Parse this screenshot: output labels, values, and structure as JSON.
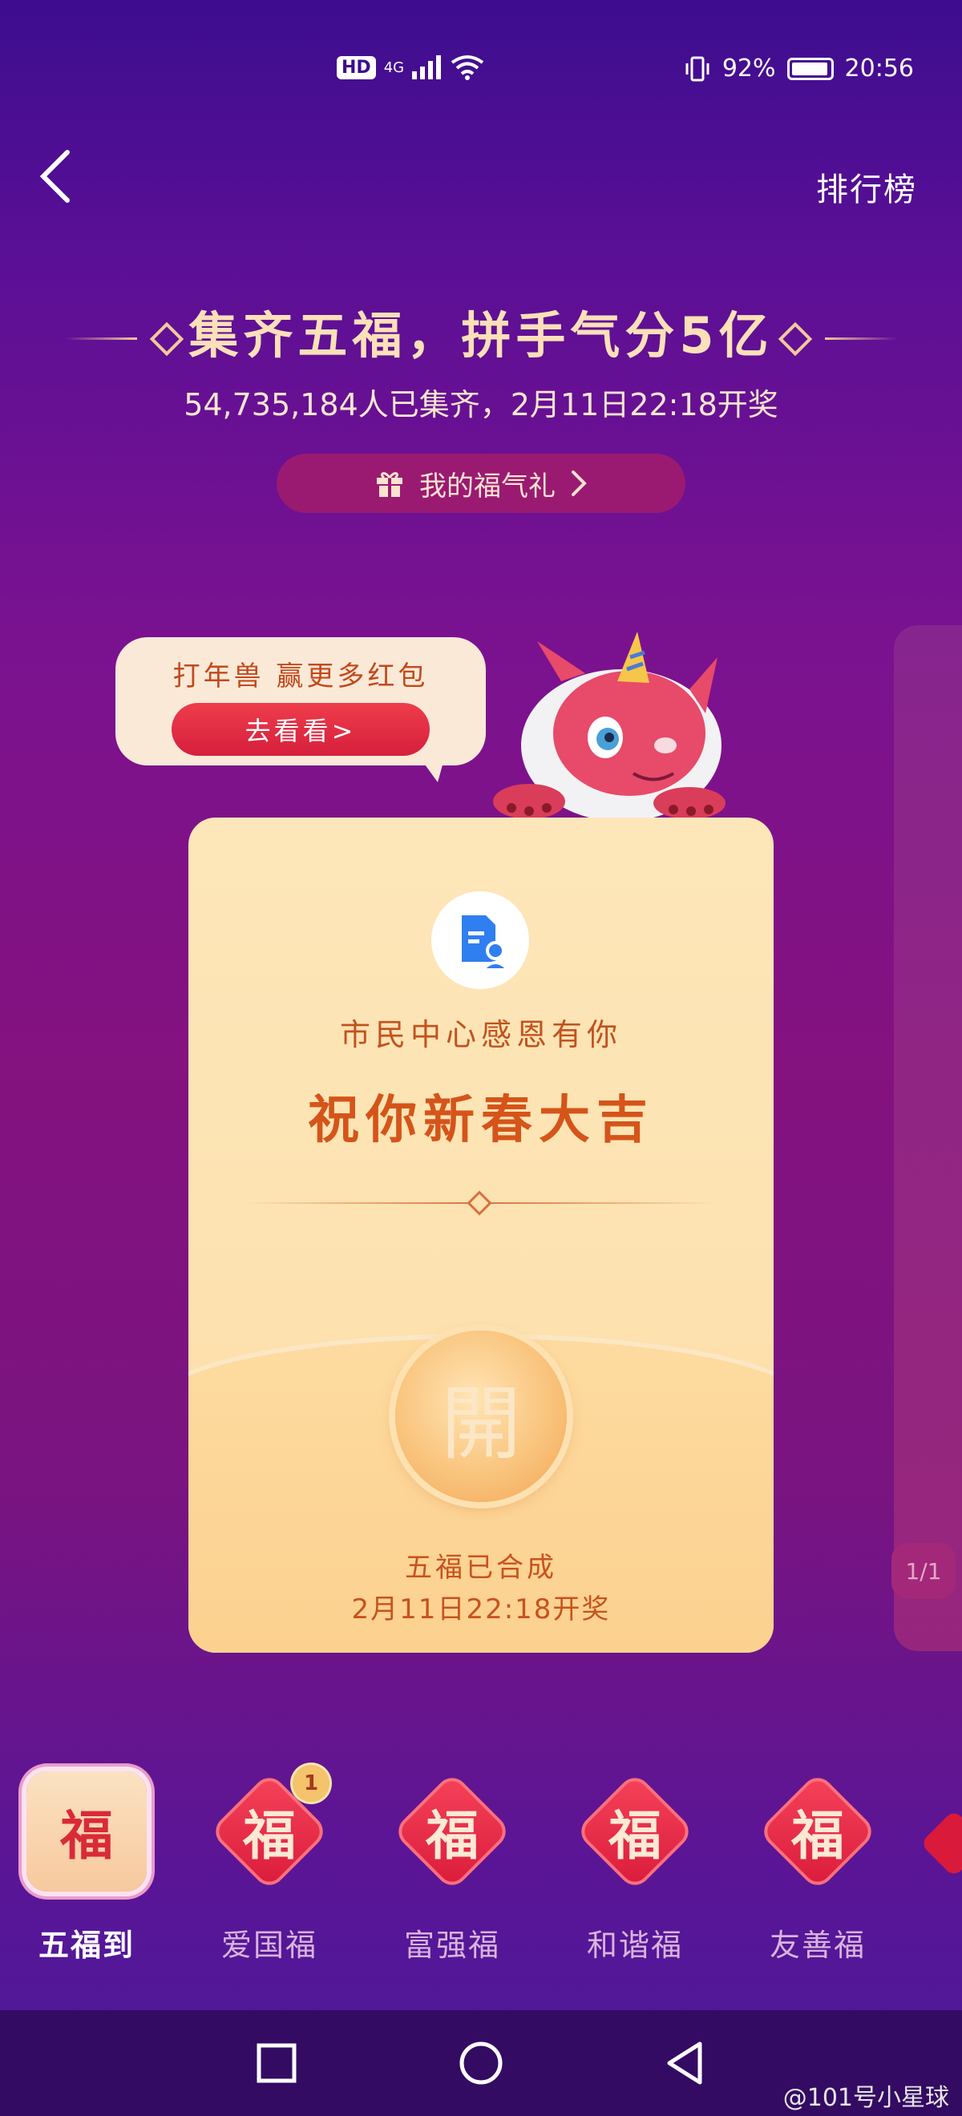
{
  "status_bar": {
    "network": "HD",
    "signal": "4G",
    "battery": "92%",
    "time": "20:56"
  },
  "header": {
    "leaderboard_label": "排行榜"
  },
  "banner": {
    "title": "集齐五福，拼手气分5亿",
    "subtitle": "54,735,184人已集齐，2月11日22:18开奖",
    "gift_button_label": "我的福气礼"
  },
  "promo": {
    "text": "打年兽 赢更多红包",
    "button_label": "去看看>"
  },
  "card": {
    "sponsor": "市民中心感恩有你",
    "greeting": "祝你新春大吉",
    "open_label": "開",
    "status": "五福已合成",
    "draw_time": "2月11日22:18开奖"
  },
  "pager": "1/1",
  "tabs": [
    {
      "label": "五福到",
      "char": "福",
      "active": true
    },
    {
      "label": "爱国福",
      "char": "福",
      "badge": "1"
    },
    {
      "label": "富强福",
      "char": "福"
    },
    {
      "label": "和谐福",
      "char": "福"
    },
    {
      "label": "友善福",
      "char": "福"
    }
  ],
  "watermark": "@101号小星球",
  "colors": {
    "accent_red": "#d91a3a",
    "card_bg": "#fde2b0",
    "text_orange": "#d5541a"
  }
}
